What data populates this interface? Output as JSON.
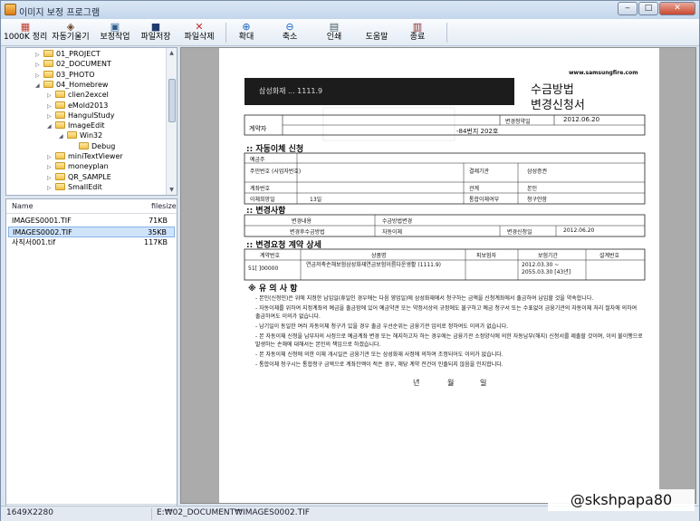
{
  "window": {
    "title": "이미지 보정 프로그램",
    "controls": {
      "minimize": "‒",
      "maximize": "□",
      "close": "✕"
    }
  },
  "toolbar": {
    "items": [
      {
        "label": "1000K 정리",
        "icon": "compress-icon",
        "glyph": "▦",
        "color": "#c0392b"
      },
      {
        "label": "자동기울기",
        "icon": "deskew-icon",
        "glyph": "◈",
        "color": "#6b4226"
      },
      {
        "label": "보정작업",
        "icon": "correction-icon",
        "glyph": "▣",
        "color": "#2e5d8a"
      },
      {
        "label": "파일저장",
        "icon": "save-icon",
        "glyph": "■",
        "color": "#1f3a6b"
      },
      {
        "label": "파일삭제",
        "icon": "delete-icon",
        "glyph": "✕",
        "color": "#c62828"
      },
      {
        "label": "확대",
        "icon": "zoom-in-icon",
        "glyph": "⊕",
        "color": "#1565c0"
      },
      {
        "label": "축소",
        "icon": "zoom-out-icon",
        "glyph": "⊖",
        "color": "#1565c0"
      },
      {
        "label": "인쇄",
        "icon": "print-icon",
        "glyph": "▤",
        "color": "#455a64"
      },
      {
        "label": "도움말",
        "icon": "help-icon",
        "glyph": "",
        "color": "#1565c0"
      },
      {
        "label": "종료",
        "icon": "exit-icon",
        "glyph": "▥",
        "color": "#8d2b2b"
      }
    ]
  },
  "folder_tree": {
    "items": [
      {
        "label": "01_PROJECT",
        "level": 0,
        "expanded": false
      },
      {
        "label": "02_DOCUMENT",
        "level": 0,
        "expanded": false
      },
      {
        "label": "03_PHOTO",
        "level": 0,
        "expanded": false
      },
      {
        "label": "04_Homebrew",
        "level": 0,
        "expanded": true
      },
      {
        "label": "clien2excel",
        "level": 1,
        "expanded": false
      },
      {
        "label": "eMold2013",
        "level": 1,
        "expanded": false
      },
      {
        "label": "HangulStudy",
        "level": 1,
        "expanded": false
      },
      {
        "label": "ImageEdit",
        "level": 1,
        "expanded": true
      },
      {
        "label": "Win32",
        "level": 2,
        "expanded": true
      },
      {
        "label": "Debug",
        "level": 3,
        "expanded": false
      },
      {
        "label": "miniTextViewer",
        "level": 1,
        "expanded": false
      },
      {
        "label": "moneyplan",
        "level": 1,
        "expanded": false
      },
      {
        "label": "QR_SAMPLE",
        "level": 1,
        "expanded": false
      },
      {
        "label": "SmallEdit",
        "level": 1,
        "expanded": false
      }
    ]
  },
  "file_list": {
    "columns": {
      "name": "Name",
      "size": "filesize"
    },
    "rows": [
      {
        "name": "IMAGES0001.TIF",
        "size": "71KB",
        "selected": false
      },
      {
        "name": "IMAGES0002.TIF",
        "size": "35KB",
        "selected": true
      },
      {
        "name": "사직서001.tif",
        "size": "117KB",
        "selected": false
      }
    ]
  },
  "document": {
    "site": "www.samsungfire.com",
    "header_code": "삼성화재 ... 1111.9",
    "title_line1": "수금방법",
    "title_line2": "변경신청서",
    "contractor_label": "계약자",
    "date_label": "변경청약일",
    "date_value": "2012.06.20",
    "address_suffix": "-84번지 202호",
    "section1": "자동이체 신청",
    "s1_rows": [
      {
        "label": "예금주",
        "field2": "",
        "value2": ""
      },
      {
        "label": "주민번호 (사업자번호)",
        "field2": "결제기관",
        "value2": "삼성증권"
      },
      {
        "label": "계좌번호",
        "field2": "관계",
        "value2": "본인"
      },
      {
        "label": "이체희망일",
        "value": "13일",
        "field2": "통합이체여부",
        "value2": "청구안함"
      }
    ],
    "section2": "변경사항",
    "s2_headers": [
      "변경내용",
      "수금방법변경"
    ],
    "s2_row": [
      "변경후수금방법",
      "자동이체",
      "변경신청일",
      "2012.06.20"
    ],
    "section3": "변경요청 계약 상세",
    "s3_headers": [
      "계약번호",
      "상품명",
      "피보험자",
      "보험기간",
      "설계번호"
    ],
    "s3_row": {
      "contract": "51[       ]00000",
      "product": "연금저축손해보험삼성화재연금보험이름다운생활 (1111.9)",
      "period": "2012.03.30 ~ 2055.03.30 [43년]"
    },
    "notes_title": "※ 유 의 사 항",
    "notes": [
      "- 본인(신청인)은 위에 지정한 납입일(휴일인 경우에는 다음 영업일)에 삼성화재에서 청구하는 금액을 신청계좌에서 출금하여 납입할 것을 약속합니다.",
      "- 자동이체를 위하여 지정계좌의 예금을 출금함에 있어 예금약관 또는 약정서상의 규정에도 불구하고 예금 청구서 또는 수표없이 금융기관의 자동이체 처리 절차에 의하여 출금하여도 이의가 없습니다.",
      "- 납기일이 동일한 여러 자동이체 청구가 있을 경우 출금 우선순위는 금융기관 임의로 정하여도 이의가 없습니다.",
      "- 본 자동이체 신청을 납부자의 사정으로 예금계좌 변경 또는 해지하고자 하는 경우에는 금융기관 소정양식에 의한 자동납부(해지) 신청서를 제출할 것이며, 이의 불이행으로 발생하는 손해에 대해서는 본인의 책임으로 하겠습니다.",
      "- 본 자동이체 신청에 의한 이체 개시일은 금융기관 또는 삼성화재 사정에 의하여 조정되어도 이의가 없습니다.",
      "- 통합이체 청구시는 통합청구 금액으로 계좌잔액이 적은 경우, 해당 계약 전건이 인출되지 않음을 인지합니다."
    ],
    "date_footer": [
      "년",
      "월",
      "일"
    ]
  },
  "status": {
    "dimensions": "1649X2280",
    "path": "E:₩02_DOCUMENT₩IMAGES0002.TIF"
  },
  "watermark": "@skshpapa80"
}
